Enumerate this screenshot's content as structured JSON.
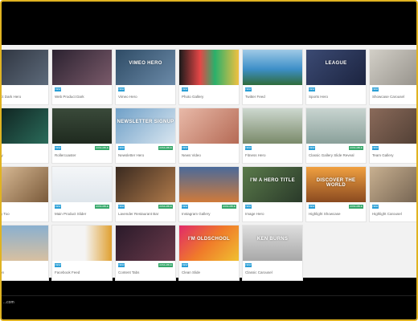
{
  "gallery": {
    "rows": [
      [
        {
          "title": "Product Dark Hero",
          "thumb_text": "",
          "bg": "linear-gradient(135deg,#2a2f3a,#5d6a7a)",
          "available": false
        },
        {
          "title": "Web Product Dark",
          "thumb_text": "",
          "bg": "linear-gradient(135deg,#2b2230,#7a5a6a)",
          "available": false
        },
        {
          "title": "Vimeo Hero",
          "thumb_text": "VIMEO HERO",
          "bg": "linear-gradient(135deg,#2f4c66,#6b8aa8)",
          "available": false
        },
        {
          "title": "Photo Gallery",
          "thumb_text": "",
          "bg": "linear-gradient(90deg,#1a1a1a,#e54747 35%,#2ab06b 60%,#f0c040)",
          "available": false
        },
        {
          "title": "Twitter Feed",
          "thumb_text": "",
          "bg": "linear-gradient(180deg,#9fc9e6,#3d8fc8 55%,#2f6b3a)",
          "available": false
        },
        {
          "title": "Sports Hero",
          "thumb_text": "LEAGUE",
          "bg": "linear-gradient(135deg,#3b4a73,#1c2440)",
          "available": false
        },
        {
          "title": "Showcase Carousel",
          "thumb_text": "",
          "bg": "linear-gradient(135deg,#d2cfc7,#8f8b84)",
          "available": false
        }
      ],
      [
        {
          "title": "Display",
          "thumb_text": "",
          "bg": "linear-gradient(135deg,#0d1b1a,#2a6b5a)",
          "available": false
        },
        {
          "title": "Rollercoaster",
          "thumb_text": "",
          "bg": "linear-gradient(180deg,#3a4a3a,#1f2a1f)",
          "available": true
        },
        {
          "title": "Newsletter Hero",
          "thumb_text": "NEWSLETTER SIGNUP",
          "bg": "linear-gradient(135deg,#6fa0c8,#d9e6f0)",
          "available": true
        },
        {
          "title": "News Video",
          "thumb_text": "",
          "bg": "linear-gradient(135deg,#e8b9a8,#b56a55)",
          "available": false
        },
        {
          "title": "Fitness Hero",
          "thumb_text": "",
          "bg": "linear-gradient(180deg,#cdd8cf,#7a8a6a)",
          "available": false
        },
        {
          "title": "Classic Gallery Slide Reveal",
          "thumb_text": "",
          "bg": "linear-gradient(180deg,#c8d4d0,#8aa09a)",
          "available": true
        },
        {
          "title": "Team Gallery",
          "thumb_text": "",
          "bg": "linear-gradient(135deg,#8a6a5a,#4a3a30)",
          "available": false
        }
      ],
      [
        {
          "title": "Gallery Too",
          "thumb_text": "",
          "bg": "linear-gradient(135deg,#e4c6a0,#7a5a3a)",
          "available": false
        },
        {
          "title": "Main Product Slider",
          "thumb_text": "",
          "bg": "linear-gradient(180deg,#f4f6f8,#dfe6ec)",
          "available": true
        },
        {
          "title": "Lavender Restaurant Bar",
          "thumb_text": "",
          "bg": "linear-gradient(135deg,#3a2a20,#b07a4a)",
          "available": true
        },
        {
          "title": "Instagram Gallery",
          "thumb_text": "",
          "bg": "linear-gradient(180deg,#4a6a9a,#d07a3a)",
          "available": true
        },
        {
          "title": "Image Hero",
          "thumb_text": "I'M A HERO TITLE",
          "bg": "linear-gradient(135deg,#5a7a4a,#2a3a2a)",
          "available": false
        },
        {
          "title": "Highlight Showcase",
          "thumb_text": "DISCOVER THE WORLD",
          "bg": "linear-gradient(180deg,#f0a040,#8a4a20)",
          "available": true
        },
        {
          "title": "Highlight Carousel",
          "thumb_text": "",
          "bg": "linear-gradient(135deg,#c8b090,#6a5a4a)",
          "available": false
        }
      ],
      [
        {
          "title": "Fashion",
          "thumb_text": "",
          "bg": "linear-gradient(180deg,#8ab0d0,#d8c0a0)",
          "available": false
        },
        {
          "title": "Facebook Feed",
          "thumb_text": "",
          "bg": "linear-gradient(90deg,#f4f4f4 55%,#e0a030)",
          "available": false
        },
        {
          "title": "Content Tabs",
          "thumb_text": "",
          "bg": "linear-gradient(135deg,#2a1a2a,#6a3a4a)",
          "available": true
        },
        {
          "title": "Clean Slide",
          "thumb_text": "I'M OLDSCHOOL",
          "bg": "linear-gradient(135deg,#e02a6a,#f07a2a 50%,#f0c030)",
          "available": false
        },
        {
          "title": "Classic Carousel",
          "thumb_text": "KEN BURNS",
          "bg": "linear-gradient(180deg,#dedede,#a8a8a8)",
          "available": false
        }
      ]
    ],
    "badge_new": "NEW",
    "badge_available": "AVAILABLE"
  },
  "footer": {
    "link": "...com"
  }
}
